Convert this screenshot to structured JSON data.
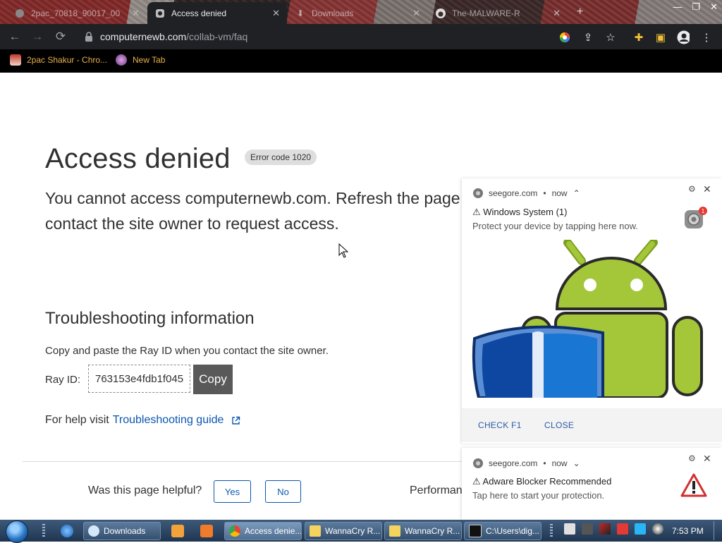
{
  "browser": {
    "tabs": [
      {
        "label": "2pac_70818_90017_00",
        "state": "background"
      },
      {
        "label": "Access denied",
        "state": "active"
      },
      {
        "label": "Downloads",
        "state": "background"
      },
      {
        "label": "The-MALWARE-R",
        "state": "background"
      }
    ],
    "url_host": "computernewb.com",
    "url_path": "/collab-vm/faq",
    "bookmarks": [
      {
        "label": "2pac Shakur - Chro..."
      },
      {
        "label": "New Tab"
      }
    ]
  },
  "page": {
    "title": "Access denied",
    "error_code": "Error code 1020",
    "description": "You cannot access computernewb.com. Refresh the page or contact the site owner to request access.",
    "troubleshooting_heading": "Troubleshooting information",
    "copy_instruction": "Copy and paste the Ray ID when you contact the site owner.",
    "ray_label": "Ray ID:",
    "ray_id": "763153e4fdb1f045",
    "copy_button": "Copy",
    "help_prefix": "For help visit",
    "help_link": "Troubleshooting guide",
    "helpful_question": "Was this page helpful?",
    "yes_button": "Yes",
    "no_button": "No",
    "performance_text": "Performance & security by Cloudflare"
  },
  "notifications": [
    {
      "source": "seegore.com",
      "time": "now",
      "title": "⚠ Windows System (1)",
      "body": "Protect your device by tapping here now.",
      "badge_count": "1",
      "actions": [
        "CHECK F1",
        "CLOSE"
      ]
    },
    {
      "source": "seegore.com",
      "time": "now",
      "title": "⚠ Adware Blocker Recommended",
      "body": "Tap here to start your protection."
    }
  ],
  "taskbar": {
    "buttons": [
      {
        "label": "Downloads"
      },
      {
        "label": "Access denie..."
      },
      {
        "label": "WannaCry R..."
      },
      {
        "label": "WannaCry R..."
      },
      {
        "label": "C:\\Users\\dig..."
      }
    ],
    "clock": "7:53 PM"
  },
  "colors": {
    "page_text": "#313131",
    "link": "#0a57b0",
    "android_green": "#a4c639",
    "shield_blue": "#1565c0",
    "warning_red": "#d32f2f"
  }
}
